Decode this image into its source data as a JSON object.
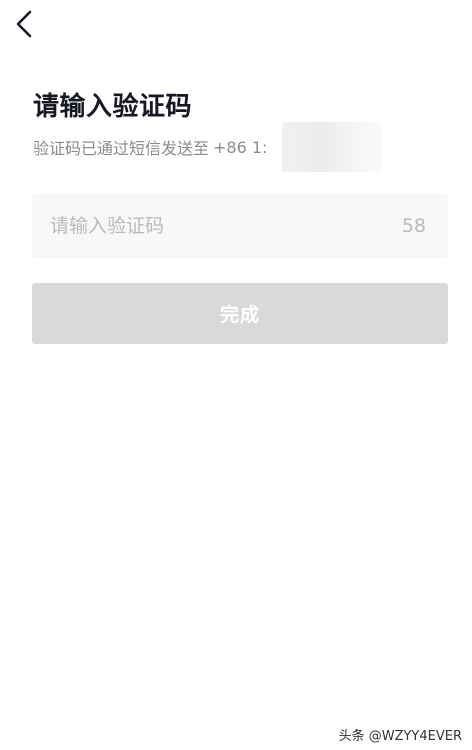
{
  "header": {
    "back_icon": "chevron-left-icon"
  },
  "main": {
    "title": "请输入验证码",
    "subtitle": "验证码已通过短信发送至",
    "phone": "+86 1:",
    "code_input": {
      "value": "",
      "placeholder": "请输入验证码"
    },
    "countdown": "58",
    "finish_label": "完成"
  },
  "watermark": "头条 @WZYY4EVER",
  "colors": {
    "title": "#161823",
    "secondary_text": "#8a8b91",
    "placeholder": "#b9babe",
    "input_background": "#f8f8f8",
    "button_disabled": "#d9d9db",
    "button_text": "#ffffff"
  }
}
